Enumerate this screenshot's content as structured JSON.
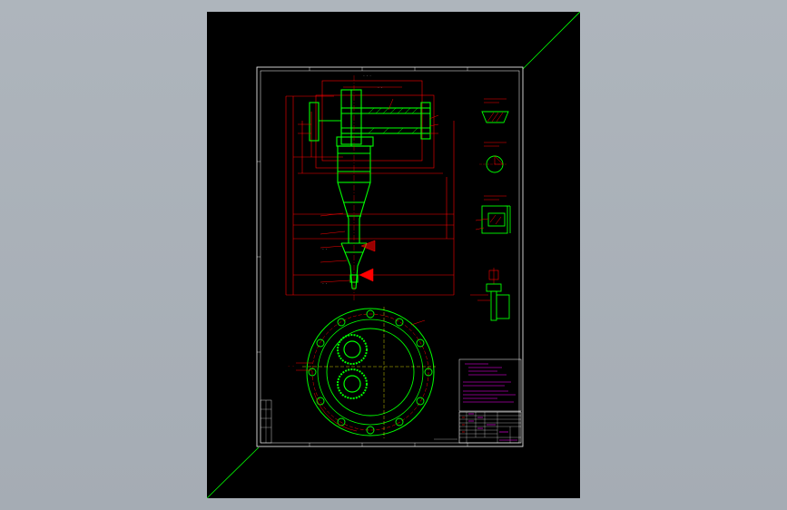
{
  "viewer": {
    "background": "#a9b0b7",
    "canvas_color": "#000000"
  },
  "drawing": {
    "colors": {
      "outline": "#00ff00",
      "dimension": "#ff0000",
      "border": "#ffffff",
      "notes": "#ff00ff"
    },
    "title_block": {
      "rows": 9
    }
  }
}
